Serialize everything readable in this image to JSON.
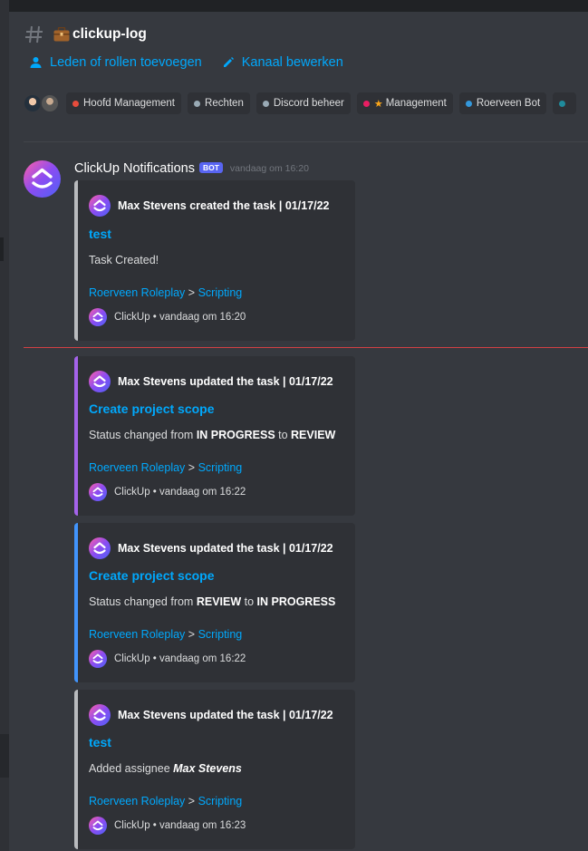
{
  "channel": {
    "name": "clickup-log",
    "hash_icon": "hash-icon",
    "emoji_icon": "briefcase-icon"
  },
  "actions": {
    "add_members": "Leden of rollen toevoegen",
    "edit_channel": "Kanaal bewerken"
  },
  "roles": [
    {
      "name": "Hoofd Management",
      "color": "#e74c3c"
    },
    {
      "name": "Rechten",
      "color": "#99aab5"
    },
    {
      "name": "Discord beheer",
      "color": "#99aab5"
    },
    {
      "name": "Management",
      "color": "#e91e63",
      "star": "★"
    },
    {
      "name": "Roerveen Bot",
      "color": "#3498db"
    },
    {
      "name": "",
      "color": "#1f8b9c"
    }
  ],
  "message": {
    "author": "ClickUp Notifications",
    "bot_tag": "BOT",
    "timestamp": "vandaag om 16:20"
  },
  "embeds": [
    {
      "author": "Max Stevens created the task | 01/17/22",
      "title": "test",
      "description": "Task Created!",
      "breadcrumb_project": "Roerveen Roleplay",
      "breadcrumb_sep": ">",
      "breadcrumb_list": "Scripting",
      "footer": "ClickUp • vandaag om 16:20",
      "color": "#b9bbbe"
    },
    {
      "author": "Max Stevens updated the task | 01/17/22",
      "title": "Create project scope",
      "desc_prefix": "Status changed from ",
      "desc_from": "IN PROGRESS",
      "desc_mid": " to ",
      "desc_to": "REVIEW",
      "breadcrumb_project": "Roerveen Roleplay",
      "breadcrumb_sep": ">",
      "breadcrumb_list": "Scripting",
      "footer": "ClickUp • vandaag om 16:22",
      "color": "#a463ea"
    },
    {
      "author": "Max Stevens updated the task | 01/17/22",
      "title": "Create project scope",
      "desc_prefix": "Status changed from ",
      "desc_from": "REVIEW",
      "desc_mid": " to ",
      "desc_to": "IN PROGRESS",
      "breadcrumb_project": "Roerveen Roleplay",
      "breadcrumb_sep": ">",
      "breadcrumb_list": "Scripting",
      "footer": "ClickUp • vandaag om 16:22",
      "color": "#4194fc"
    },
    {
      "author": "Max Stevens updated the task | 01/17/22",
      "title": "test",
      "desc_prefix": "Added assignee ",
      "desc_assignee": "Max Stevens",
      "breadcrumb_project": "Roerveen Roleplay",
      "breadcrumb_sep": ">",
      "breadcrumb_list": "Scripting",
      "footer": "ClickUp • vandaag om 16:23",
      "color": "#b9bbbe"
    }
  ],
  "colors": {
    "link": "#00a8fc",
    "new_messages_divider": "#ed4245",
    "bot_tag": "#5865f2"
  }
}
